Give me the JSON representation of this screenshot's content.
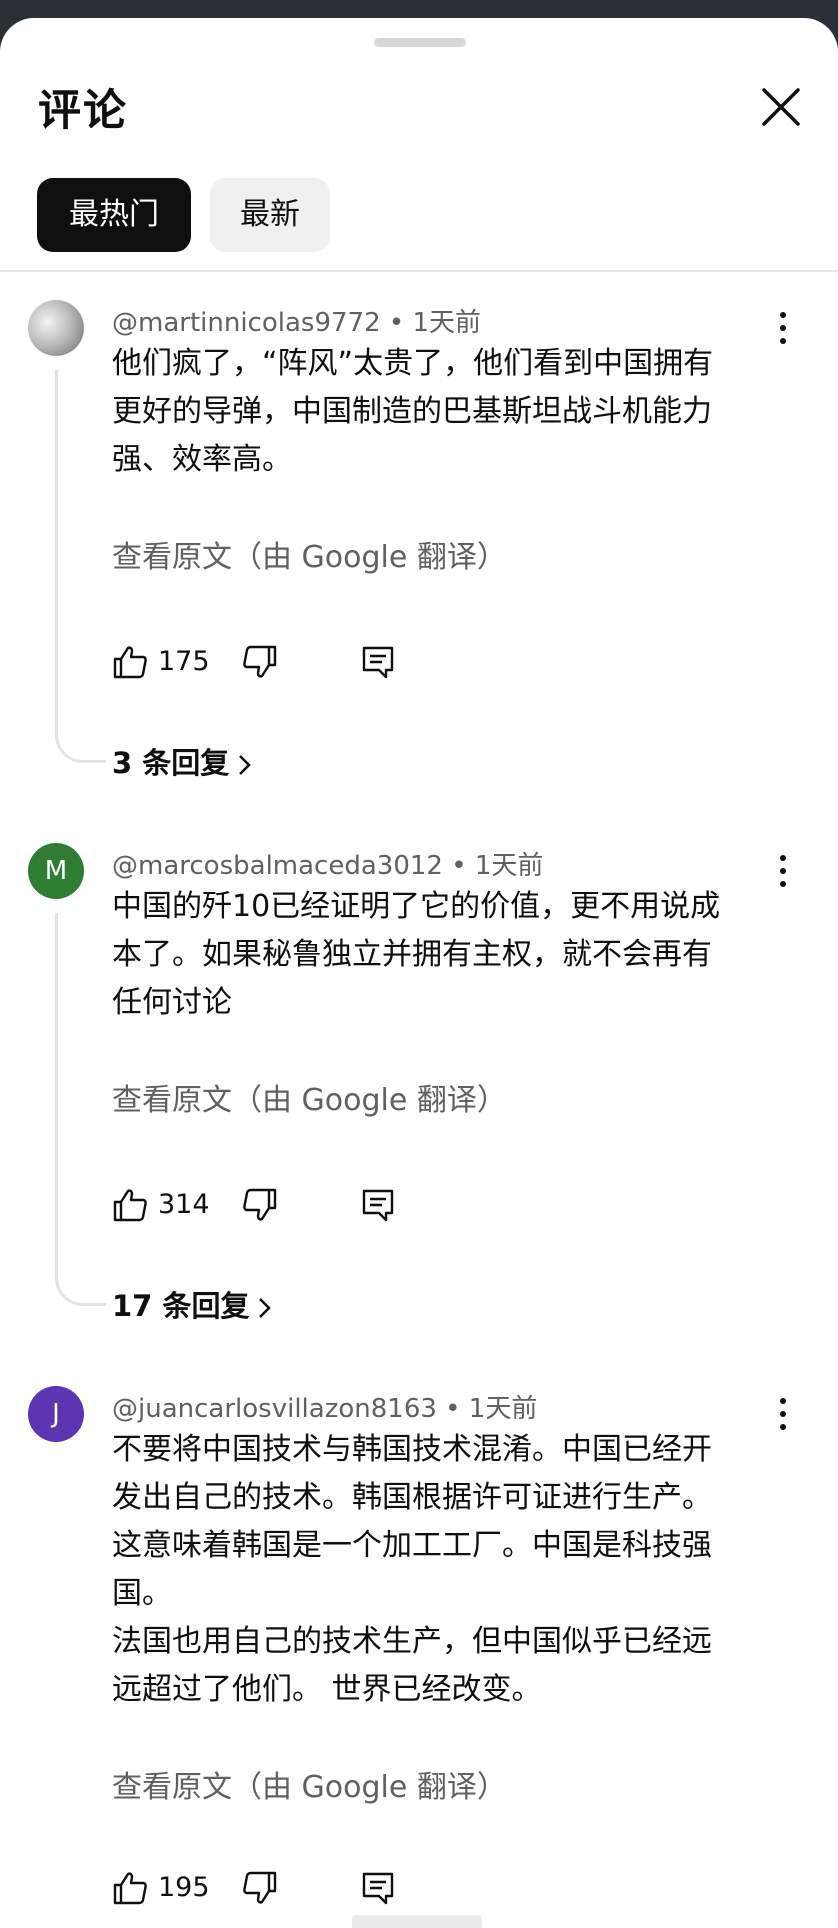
{
  "header": {
    "title": "评论",
    "close_icon": "close-icon"
  },
  "tabs": [
    {
      "label": "最热门",
      "selected": true
    },
    {
      "label": "最新",
      "selected": false
    }
  ],
  "comments": [
    {
      "avatar_letter": "",
      "avatar_color": "#9e9e9e",
      "author": "@martinnicolas9772",
      "time": "1天前",
      "text": "他们疯了，“阵风”太贵了，他们看到中国拥有\n更好的导弹，中国制造的巴基斯坦战斗机能力\n强、效率高。",
      "translate_label": "查看原文（由 Google 翻译）",
      "likes": "175",
      "replies_label": "3 条回复"
    },
    {
      "avatar_letter": "M",
      "avatar_color": "#2e7d32",
      "author": "@marcosbalmaceda3012",
      "time": "1天前",
      "text": "中国的歼10已经证明了它的价值，更不用说成\n本了。如果秘鲁独立并拥有主权，就不会再有\n任何讨论",
      "translate_label": "查看原文（由 Google 翻译）",
      "likes": "314",
      "replies_label": "17 条回复"
    },
    {
      "avatar_letter": "J",
      "avatar_color": "#5e35b1",
      "author": "@juancarlosvillazon8163",
      "time": "1天前",
      "text": "不要将中国技术与韩国技术混淆。中国已经开\n发出自己的技术。韩国根据许可证进行生产。\n这意味着韩国是一个加工工厂。中国是科技强\n国。\n法国也用自己的技术生产，但中国似乎已经远\n远超过了他们。 世界已经改变。",
      "translate_label": "查看原文（由 Google 翻译）",
      "likes": "195"
    }
  ],
  "separator": "•",
  "icons": [
    "thumb-up-icon",
    "thumb-down-icon",
    "reply-icon",
    "more-vert-icon",
    "chevron-right-icon"
  ]
}
